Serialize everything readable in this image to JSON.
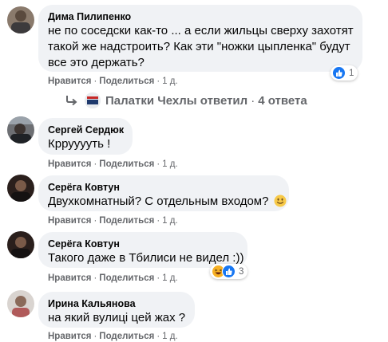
{
  "comments": [
    {
      "author": "Дима Пилипенко",
      "lines": [
        "не по соседски как-то ... а если жильцы сверху захотят",
        "такой же надстроить? Как эти \"ножки цыпленка\" будут",
        "все это держать?"
      ],
      "like": "Нравится",
      "reply": "Поделиться",
      "time": "1 д.",
      "reaction_count": "1"
    },
    {
      "author": "Сергей Сердюк",
      "lines": [
        "Кррууууть !"
      ],
      "like": "Нравится",
      "reply": "Поделиться",
      "time": "1 д."
    },
    {
      "author": "Серёга Ковтун",
      "lines": [
        "Двухкомнатный? С отдельным входом?"
      ],
      "like": "Нравится",
      "reply": "Поделиться",
      "time": "1 д."
    },
    {
      "author": "Серёга Ковтун",
      "lines": [
        "Такого даже в Тбилиси не видел :))"
      ],
      "like": "Нравится",
      "reply": "Поделиться",
      "time": "1 д.",
      "reaction_count": "3"
    },
    {
      "author": "Ирина Кальянова",
      "lines": [
        "на який вулиці цей жах ?"
      ],
      "like": "Нравится",
      "reply": "Поделиться",
      "time": "1 д."
    }
  ],
  "replies_summary": {
    "author": "Палатки Чехлы",
    "verb": "ответил",
    "count": "4 ответа"
  },
  "icons": {
    "reply_arrow": "reply-arrow-icon",
    "like_reaction": "like-reaction-icon",
    "haha_reaction": "haha-reaction-icon",
    "smile_emoji": "smile-emoji-icon"
  },
  "colors": {
    "bubble": "#f0f2f5",
    "secondary_text": "#65676b",
    "like_blue": "#1877f2"
  }
}
